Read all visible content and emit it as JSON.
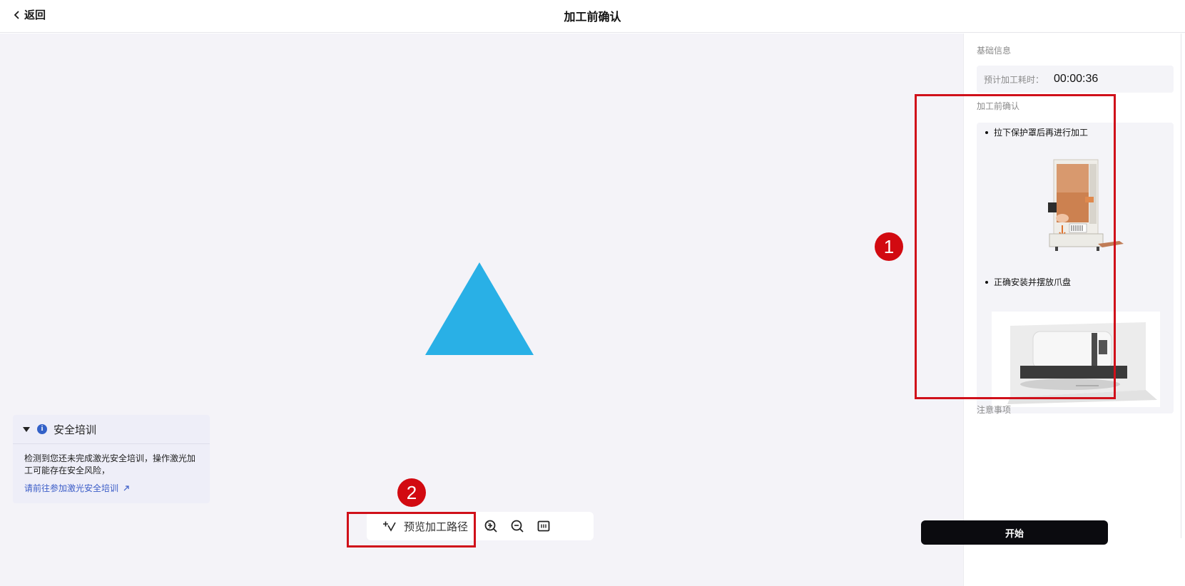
{
  "header": {
    "back_label": "返回",
    "title": "加工前确认"
  },
  "canvas": {
    "shape": "triangle",
    "shape_color": "#29b0e6",
    "background": "#f4f3f8"
  },
  "toolbar": {
    "preview_label": "预览加工路径",
    "icons": [
      "preview-path-icon",
      "chevron-right-icon",
      "zoom-in-icon",
      "zoom-out-icon",
      "fit-screen-icon"
    ]
  },
  "annotations": {
    "badge_1": "1",
    "badge_2": "2",
    "highlight_color": "#d0101a"
  },
  "sidebar": {
    "basic_info": {
      "label": "基础信息",
      "time_key": "预计加工耗时：",
      "time_value": "00:00:36"
    },
    "confirm": {
      "label": "加工前确认",
      "items": [
        {
          "text": "拉下保护罩后再进行加工"
        },
        {
          "text": "正确安装并摆放爪盘"
        }
      ]
    },
    "notice": {
      "label": "注意事项",
      "title": "安全培训",
      "text": "检测到您还未完成激光安全培训，操作激光加工可能存在安全风险，",
      "link": "请前往参加激光安全培训"
    },
    "start_label": "开始",
    "start_color": "#0b0b0f"
  }
}
